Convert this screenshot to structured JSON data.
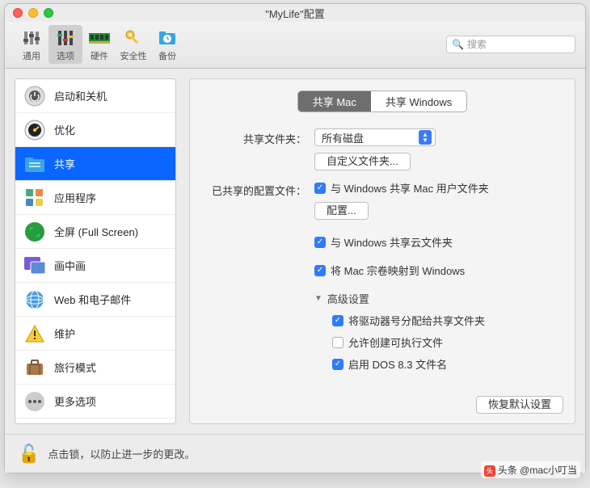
{
  "window": {
    "title": "\"MyLife\"配置"
  },
  "toolbar": {
    "items": [
      {
        "label": "通用",
        "icon": "sliders"
      },
      {
        "label": "选项",
        "icon": "options",
        "selected": true
      },
      {
        "label": "硬件",
        "icon": "ram"
      },
      {
        "label": "安全性",
        "icon": "key"
      },
      {
        "label": "备份",
        "icon": "clock-folder"
      }
    ],
    "search_placeholder": "搜索"
  },
  "sidebar": {
    "items": [
      {
        "label": "启动和关机",
        "icon": "power"
      },
      {
        "label": "优化",
        "icon": "gauge"
      },
      {
        "label": "共享",
        "icon": "folder-share",
        "selected": true
      },
      {
        "label": "应用程序",
        "icon": "apps"
      },
      {
        "label": "全屏 (Full Screen)",
        "icon": "fullscreen"
      },
      {
        "label": "画中画",
        "icon": "pip"
      },
      {
        "label": "Web 和电子邮件",
        "icon": "globe"
      },
      {
        "label": "维护",
        "icon": "warning"
      },
      {
        "label": "旅行模式",
        "icon": "suitcase"
      },
      {
        "label": "更多选项",
        "icon": "dots"
      }
    ]
  },
  "content": {
    "tabs": {
      "mac": "共享 Mac",
      "windows": "共享 Windows",
      "active": "mac"
    },
    "share_folder_label": "共享文件夹：",
    "share_folder_value": "所有磁盘",
    "custom_folder_btn": "自定义文件夹...",
    "shared_profile_label": "已共享的配置文件：",
    "chk_win_mac_user": {
      "label": "与 Windows 共享 Mac 用户文件夹",
      "checked": true
    },
    "config_btn": "配置...",
    "chk_win_cloud": {
      "label": "与 Windows 共享云文件夹",
      "checked": true
    },
    "chk_map_volumes": {
      "label": "将 Mac 宗卷映射到 Windows",
      "checked": true
    },
    "advanced_label": "高级设置",
    "adv": {
      "drive_letters": {
        "label": "将驱动器号分配给共享文件夹",
        "checked": true
      },
      "allow_exec": {
        "label": "允许创建可执行文件",
        "checked": false
      },
      "dos83": {
        "label": "启用 DOS 8.3 文件名",
        "checked": true
      }
    },
    "restore_btn": "恢复默认设置"
  },
  "footer": {
    "text": "点击锁，以防止进一步的更改。"
  },
  "watermark": "头条 @mac小叮当"
}
